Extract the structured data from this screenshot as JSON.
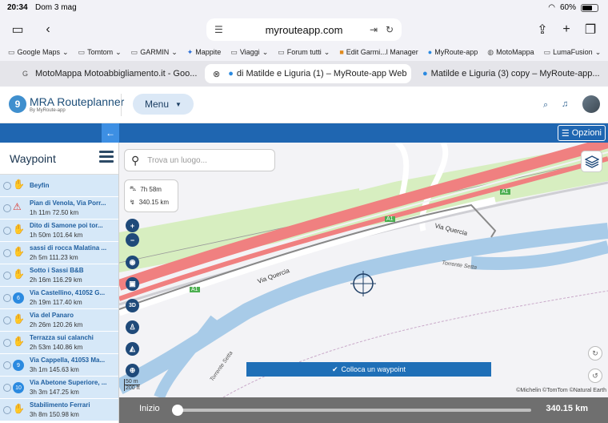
{
  "status": {
    "time": "20:34",
    "date": "Dom 3 mag",
    "battery": "60%"
  },
  "browser": {
    "url": "myrouteapp.com",
    "bookmarks": [
      "Google Maps",
      "Tomtom",
      "GARMIN",
      "Mappite",
      "Viaggi",
      "Forum tutti",
      "Edit Garmi...l Manager",
      "MyRoute-app",
      "MotoMappa",
      "LumaFusion"
    ],
    "tabs": [
      {
        "label": "MotoMappa Motoabbigliamento.it - Goo..."
      },
      {
        "label": "di Matilde e Liguria (1) – MyRoute-app Web"
      },
      {
        "label": "Matilde e Liguria (3) copy – MyRoute-app..."
      }
    ]
  },
  "header": {
    "brand": "MRA Routeplanner",
    "brand_sub": "By MyRoute-app",
    "menu_label": "Menu"
  },
  "bluebar": {
    "options_label": "Opzioni"
  },
  "sidebar": {
    "title": "Waypoint",
    "items": [
      {
        "name": "Beyfin",
        "info": ""
      },
      {
        "name": "Pian di Venola, Via Porr...",
        "info": "1h 11m   72.50 km"
      },
      {
        "name": "Dito di Samone poi tor...",
        "info": "1h 50m   101.64 km"
      },
      {
        "name": "sassi di rocca Malatina ...",
        "info": "2h 5m   111.23 km"
      },
      {
        "name": "Sotto i Sassi B&B",
        "info": "2h 16m   116.29 km"
      },
      {
        "name": "Via Castellino, 41052 G...",
        "info": "2h 19m   117.40 km",
        "num": "6"
      },
      {
        "name": "Via del Panaro",
        "info": "2h 26m   120.26 km"
      },
      {
        "name": "Terrazza sui calanchi",
        "info": "2h 53m   140.86 km"
      },
      {
        "name": "Via Cappella, 41053 Ma...",
        "info": "3h 1m   145.63 km",
        "num": "9"
      },
      {
        "name": "Via Abetone Superiore, ...",
        "info": "3h 3m   147.25 km",
        "num": "10"
      },
      {
        "name": "Stabilimento Ferrari",
        "info": "3h 8m   150.98 km"
      }
    ]
  },
  "map": {
    "search_placeholder": "Trova un luogo...",
    "duration": "7h 58m",
    "distance": "340.15 km",
    "road_label_1": "Via Quercia",
    "road_label_2": "Via Quercia",
    "highway_label": "A1",
    "river_label": "Torrente Setta",
    "river_label_2": "Torrente Setta",
    "place_waypoint_label": "Colloca un waypoint",
    "scale_m": "50 m",
    "scale_ft": "200 ft",
    "credits": "©Michelin ©TomTom ©Natural Earth",
    "btn_3d": "3D"
  },
  "bottom": {
    "start_label": "Inizio",
    "total_km": "340.15 km",
    "progress": 0
  }
}
